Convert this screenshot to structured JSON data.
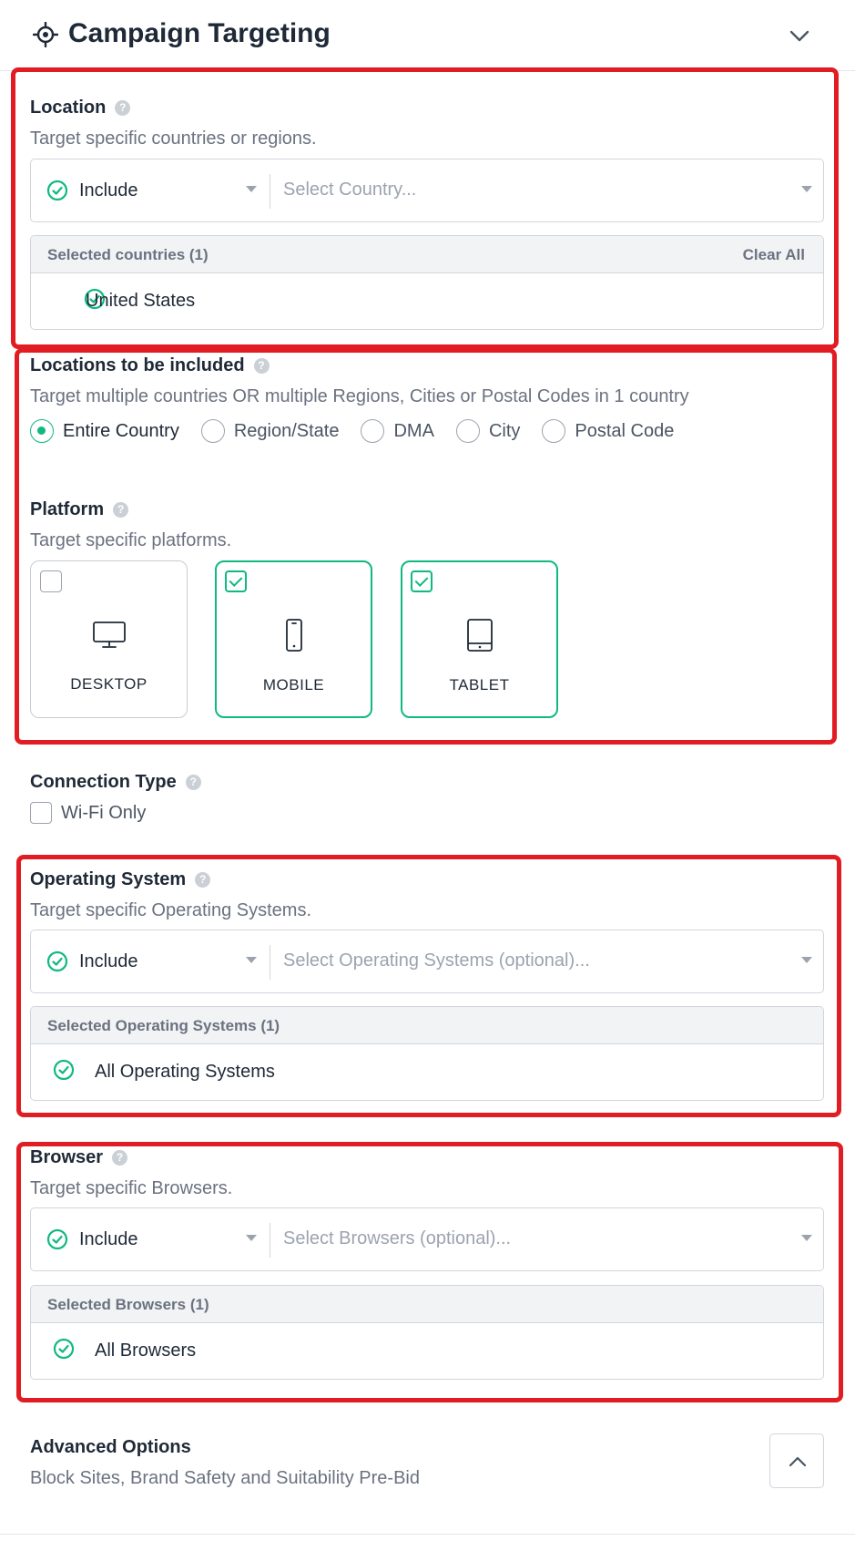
{
  "header": {
    "title": "Campaign Targeting"
  },
  "location": {
    "label": "Location",
    "help": "?",
    "description": "Target specific countries or regions.",
    "mode": "Include",
    "placeholder": "Select Country...",
    "selected_title": "Selected countries (1)",
    "clear_all": "Clear All",
    "selected": [
      "United States"
    ]
  },
  "locations_included": {
    "label": "Locations to be included",
    "help": "?",
    "description": "Target multiple countries OR multiple Regions, Cities or Postal Codes in 1 country",
    "options": [
      "Entire Country",
      "Region/State",
      "DMA",
      "City",
      "Postal Code"
    ],
    "selected": "Entire Country"
  },
  "platform": {
    "label": "Platform",
    "help": "?",
    "description": "Target specific platforms.",
    "items": [
      {
        "label": "DESKTOP",
        "icon": "desktop-icon",
        "checked": false
      },
      {
        "label": "MOBILE",
        "icon": "mobile-icon",
        "checked": true
      },
      {
        "label": "TABLET",
        "icon": "tablet-icon",
        "checked": true
      }
    ]
  },
  "connection": {
    "label": "Connection Type",
    "help": "?",
    "wifi_label": "Wi-Fi Only",
    "wifi_checked": false
  },
  "os": {
    "label": "Operating System",
    "help": "?",
    "description": "Target specific Operating Systems.",
    "mode": "Include",
    "placeholder": "Select Operating Systems (optional)...",
    "selected_title": "Selected Operating Systems (1)",
    "selected": [
      "All Operating Systems"
    ]
  },
  "browser": {
    "label": "Browser",
    "help": "?",
    "description": "Target specific Browsers.",
    "mode": "Include",
    "placeholder": "Select Browsers (optional)...",
    "selected_title": "Selected Browsers (1)",
    "selected": [
      "All Browsers"
    ]
  },
  "advanced": {
    "label": "Advanced Options",
    "description": "Block Sites, Brand Safety and Suitability Pre-Bid"
  },
  "colors": {
    "accent": "#10b981",
    "highlight": "#e11d23",
    "muted_text": "#6b7280"
  }
}
